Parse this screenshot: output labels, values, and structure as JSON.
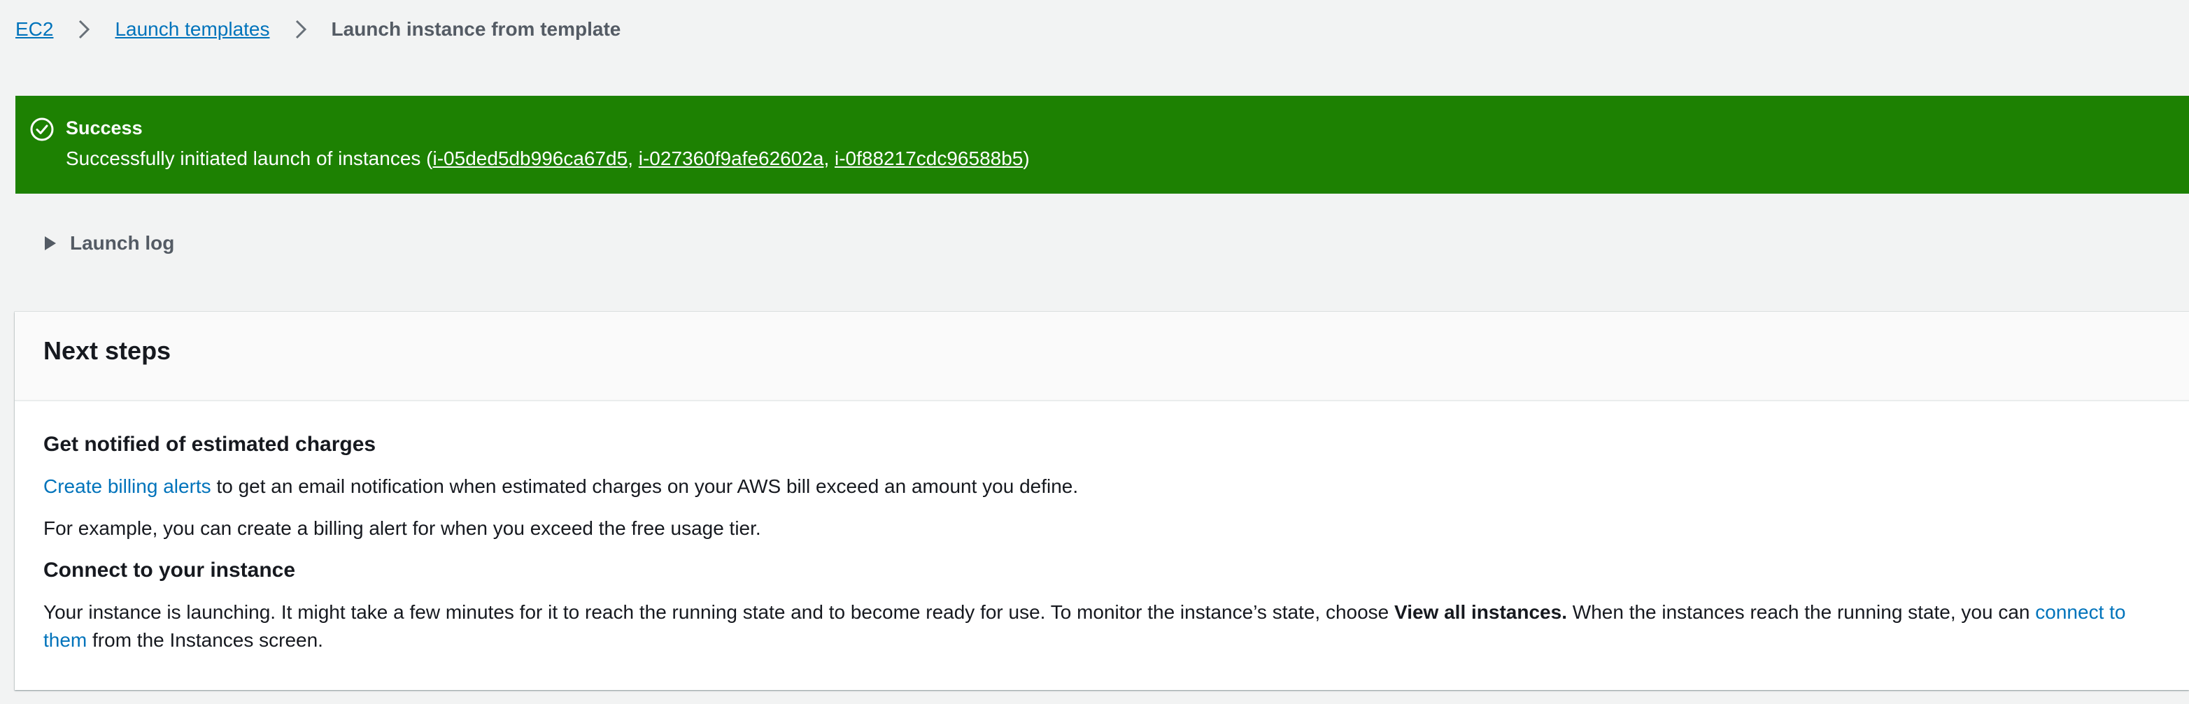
{
  "breadcrumb": {
    "items": [
      "EC2",
      "Launch templates"
    ],
    "current": "Launch instance from template"
  },
  "flash": {
    "type": "success",
    "title": "Success",
    "message_prefix": "Successfully initiated launch of instances (",
    "instances": [
      "i-05ded5db996ca67d5",
      "i-027360f9afe62602a",
      "i-0f88217cdc96588b5"
    ],
    "separator": ", ",
    "message_suffix": ")",
    "color": "#1d8102",
    "icon": "check-circle-icon"
  },
  "launch_log": {
    "label": "Launch log",
    "expanded": false,
    "icon": "caret-right-icon"
  },
  "next_steps": {
    "title": "Next steps",
    "billing": {
      "heading": "Get notified of estimated charges",
      "link": "Create billing alerts",
      "text_after_link": " to get an email notification when estimated charges on your AWS bill exceed an amount you define.",
      "example": "For example, you can create a billing alert for when you exceed the free usage tier."
    },
    "connect": {
      "heading": "Connect to your instance",
      "text_before_bold": "Your instance is launching. It might take a few minutes for it to reach the running state and to become ready for use. To monitor the instance’s state, choose ",
      "bold": "View all instances.",
      "text_after_bold": " When the instances reach the running state, you can ",
      "link": "connect to them",
      "text_end": " from the Instances screen."
    }
  },
  "colors": {
    "link": "#0073bb",
    "background": "#f2f3f3",
    "text": "#16191f",
    "secondary_text": "#545b64"
  }
}
